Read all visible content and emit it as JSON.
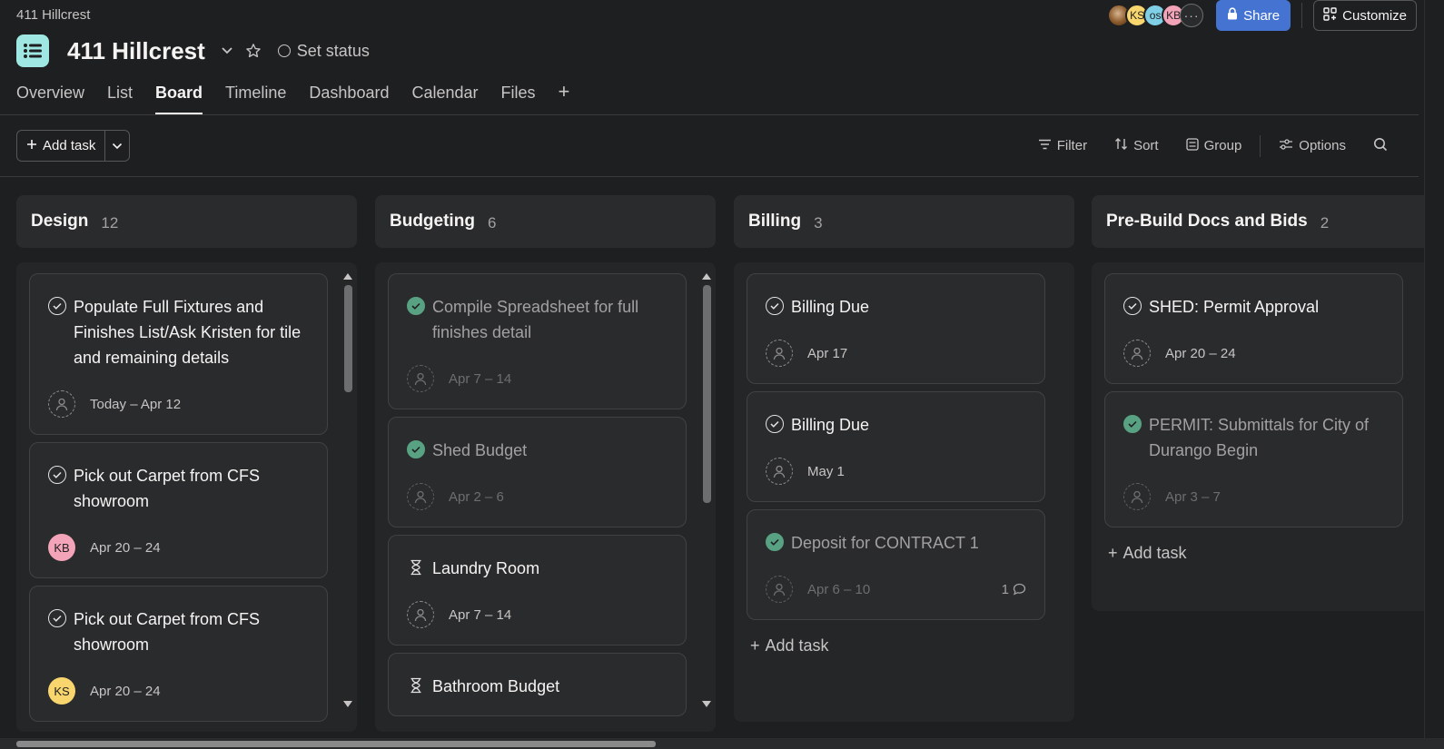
{
  "window_title": "411 Hillcrest",
  "project": {
    "title": "411 Hillcrest",
    "set_status": "Set status",
    "icon_color": "#9ee7e3"
  },
  "header_right": {
    "avatars": [
      "photo",
      "KS",
      "os",
      "KB"
    ],
    "share": "Share",
    "customize": "Customize"
  },
  "tabs": [
    "Overview",
    "List",
    "Board",
    "Timeline",
    "Dashboard",
    "Calendar",
    "Files"
  ],
  "active_tab": "Board",
  "toolbar": {
    "add_task": "Add task",
    "filter": "Filter",
    "sort": "Sort",
    "group": "Group",
    "options": "Options"
  },
  "colors": {
    "share_blue": "#4573d2",
    "done_green": "#58a182",
    "avatar_ks": "#f8d66d",
    "avatar_kb": "#f4a4b8",
    "avatar_os": "#7fd0e6"
  },
  "columns": [
    {
      "title": "Design",
      "count": "12",
      "cards": [
        {
          "title": "Populate Full Fixtures and Finishes List/Ask Kristen for tile and remaining details",
          "due": "Today – Apr 12",
          "assignee": ""
        },
        {
          "title": "Pick out Carpet from CFS showroom",
          "due": "Apr 20 – 24",
          "assignee": "KB"
        },
        {
          "title": "Pick out Carpet from CFS showroom",
          "due": "Apr 20 – 24",
          "assignee": "KS"
        }
      ]
    },
    {
      "title": "Budgeting",
      "count": "6",
      "cards": [
        {
          "title": "Compile Spreadsheet for full finishes detail",
          "due": "Apr 7 – 14",
          "status": "done"
        },
        {
          "title": "Shed Budget",
          "due": "Apr 2 – 6",
          "status": "done"
        },
        {
          "title": "Laundry Room",
          "due": "Apr 7 – 14",
          "status": "pending"
        },
        {
          "title": "Bathroom Budget",
          "status": "pending"
        }
      ]
    },
    {
      "title": "Billing",
      "count": "3",
      "cards": [
        {
          "title": "Billing Due",
          "due": "Apr 17"
        },
        {
          "title": "Billing Due",
          "due": "May 1"
        },
        {
          "title": "Deposit for CONTRACT 1",
          "due": "Apr 6 – 10",
          "comments": "1",
          "status": "done"
        }
      ],
      "add_task": "Add task"
    },
    {
      "title": "Pre-Build Docs and Bids",
      "count": "2",
      "cards": [
        {
          "title": "SHED: Permit Approval",
          "due": "Apr 20 – 24"
        },
        {
          "title": "PERMIT: Submittals for City of Durango Begin",
          "due": "Apr 3 – 7",
          "status": "done"
        }
      ],
      "add_task": "Add task"
    }
  ]
}
